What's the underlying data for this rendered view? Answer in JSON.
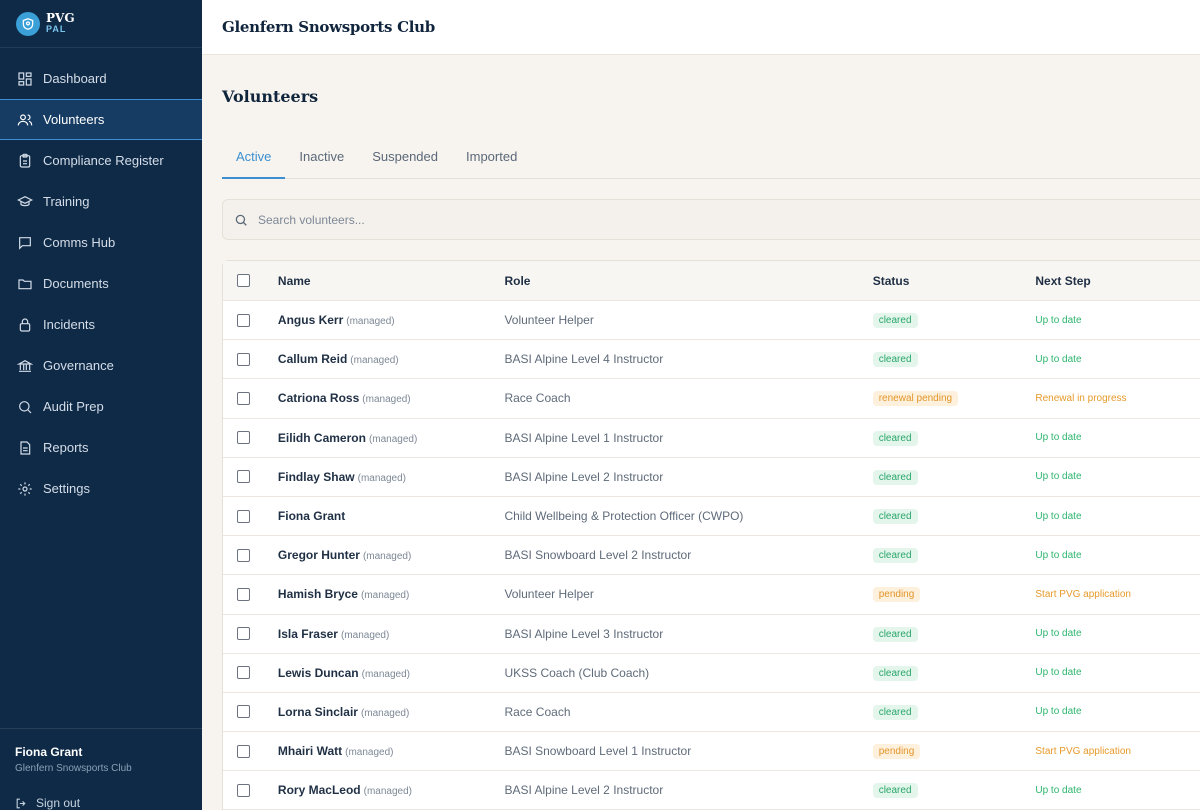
{
  "brand": {
    "name": "PVG",
    "sub": "PAL"
  },
  "nav": [
    {
      "label": "Dashboard",
      "icon": "dashboard-icon"
    },
    {
      "label": "Volunteers",
      "icon": "users-icon",
      "active": true
    },
    {
      "label": "Compliance Register",
      "icon": "clipboard-icon"
    },
    {
      "label": "Training",
      "icon": "graduation-cap-icon"
    },
    {
      "label": "Comms Hub",
      "icon": "chat-icon"
    },
    {
      "label": "Documents",
      "icon": "folder-icon"
    },
    {
      "label": "Incidents",
      "icon": "lock-icon"
    },
    {
      "label": "Governance",
      "icon": "building-icon"
    },
    {
      "label": "Audit Prep",
      "icon": "search-icon"
    },
    {
      "label": "Reports",
      "icon": "report-icon"
    },
    {
      "label": "Settings",
      "icon": "gear-icon"
    }
  ],
  "user": {
    "name": "Fiona Grant",
    "org": "Glenfern Snowsports Club",
    "signout": "Sign out"
  },
  "header": {
    "org_title": "Glenfern Snowsports Club"
  },
  "page": {
    "title": "Volunteers"
  },
  "tabs": [
    "Active",
    "Inactive",
    "Suspended",
    "Imported"
  ],
  "search": {
    "placeholder": "Search volunteers..."
  },
  "table": {
    "headers": {
      "name": "Name",
      "role": "Role",
      "status": "Status",
      "next": "Next Step"
    },
    "rows": [
      {
        "name": "Angus Kerr",
        "managed": "(managed)",
        "role": "Volunteer Helper",
        "status": "cleared",
        "next": "Up to date"
      },
      {
        "name": "Callum Reid",
        "managed": "(managed)",
        "role": "BASI Alpine Level 4 Instructor",
        "status": "cleared",
        "next": "Up to date"
      },
      {
        "name": "Catriona Ross",
        "managed": "(managed)",
        "role": "Race Coach",
        "status": "renewal pending",
        "next": "Renewal in progress"
      },
      {
        "name": "Eilidh Cameron",
        "managed": "(managed)",
        "role": "BASI Alpine Level 1 Instructor",
        "status": "cleared",
        "next": "Up to date"
      },
      {
        "name": "Findlay Shaw",
        "managed": "(managed)",
        "role": "BASI Alpine Level 2 Instructor",
        "status": "cleared",
        "next": "Up to date"
      },
      {
        "name": "Fiona Grant",
        "managed": "",
        "role": "Child Wellbeing & Protection Officer (CWPO)",
        "status": "cleared",
        "next": "Up to date"
      },
      {
        "name": "Gregor Hunter",
        "managed": "(managed)",
        "role": "BASI Snowboard Level 2 Instructor",
        "status": "cleared",
        "next": "Up to date"
      },
      {
        "name": "Hamish Bryce",
        "managed": "(managed)",
        "role": "Volunteer Helper",
        "status": "pending",
        "next": "Start PVG application"
      },
      {
        "name": "Isla Fraser",
        "managed": "(managed)",
        "role": "BASI Alpine Level 3 Instructor",
        "status": "cleared",
        "next": "Up to date"
      },
      {
        "name": "Lewis Duncan",
        "managed": "(managed)",
        "role": "UKSS Coach (Club Coach)",
        "status": "cleared",
        "next": "Up to date"
      },
      {
        "name": "Lorna Sinclair",
        "managed": "(managed)",
        "role": "Race Coach",
        "status": "cleared",
        "next": "Up to date"
      },
      {
        "name": "Mhairi Watt",
        "managed": "(managed)",
        "role": "BASI Snowboard Level 1 Instructor",
        "status": "pending",
        "next": "Start PVG application"
      },
      {
        "name": "Rory MacLeod",
        "managed": "(managed)",
        "role": "BASI Alpine Level 2 Instructor",
        "status": "cleared",
        "next": "Up to date"
      }
    ]
  }
}
